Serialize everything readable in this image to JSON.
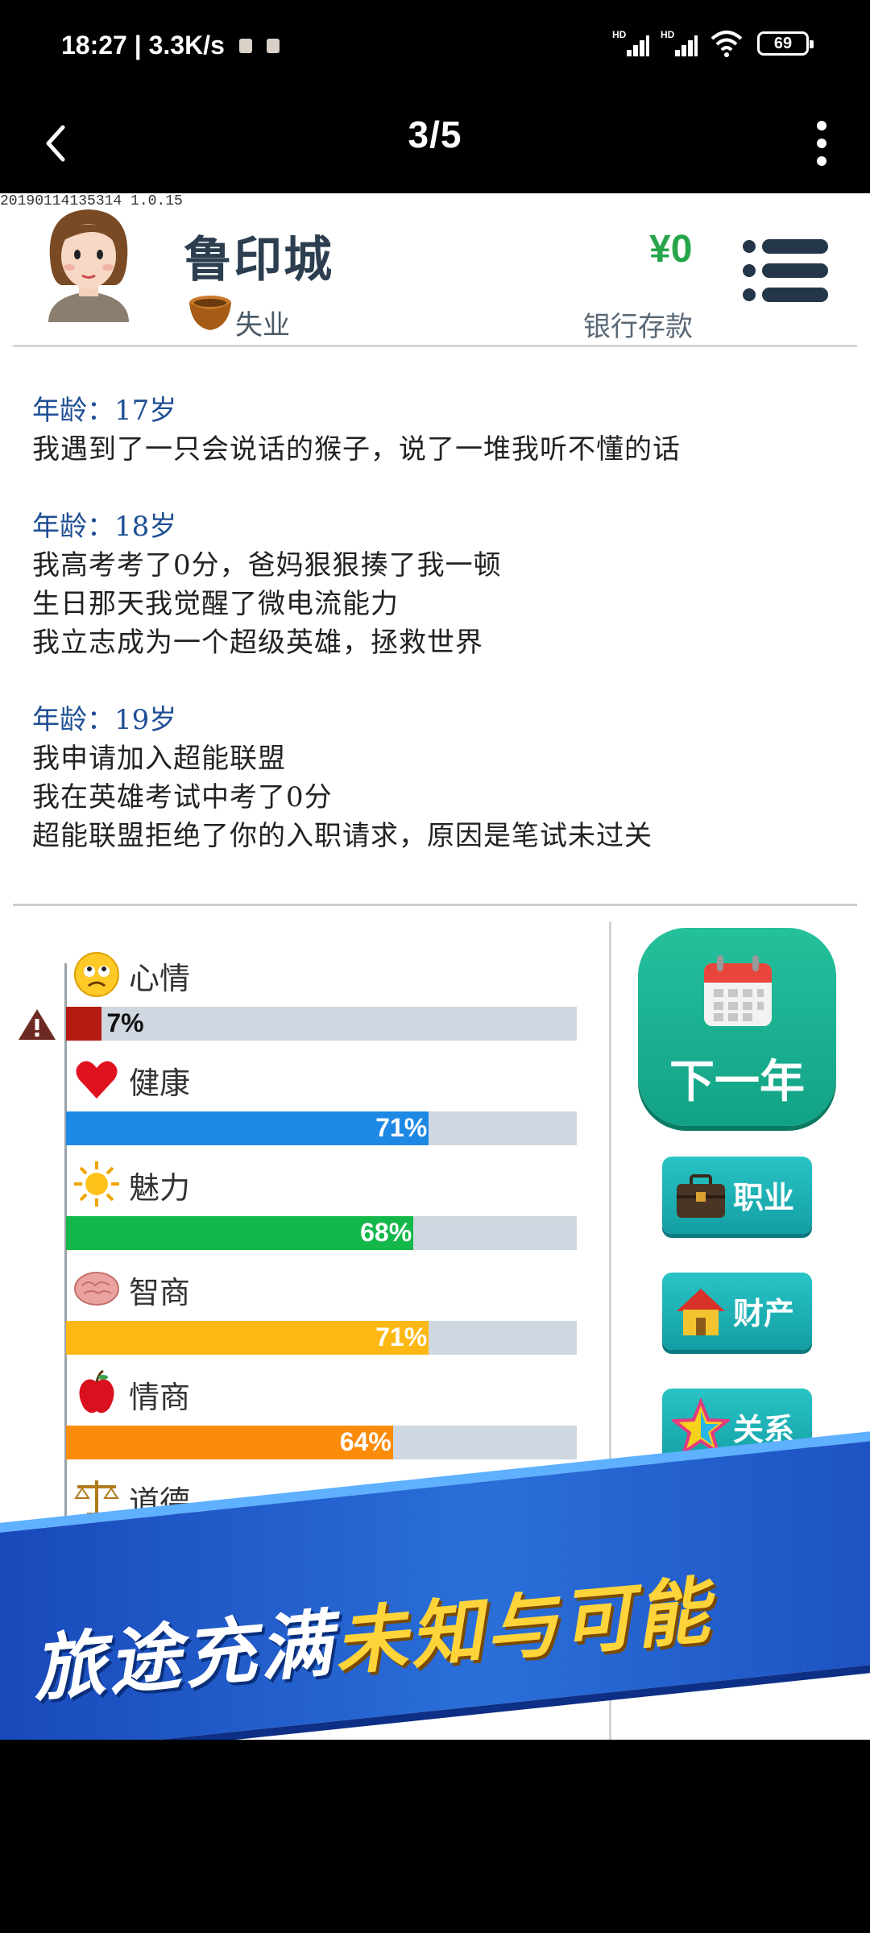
{
  "status_bar": {
    "time_speed": "18:27 | 3.3K/s",
    "battery": "69"
  },
  "nav": {
    "page_indicator": "3/5"
  },
  "game": {
    "version": "20190114135314 1.0.15",
    "player": {
      "name": "鲁印城",
      "job": "失业",
      "money": "¥0",
      "bank_label": "银行存款"
    },
    "log": [
      {
        "age": "年龄：17岁",
        "lines": [
          "我遇到了一只会说话的猴子，说了一堆我听不懂的话"
        ]
      },
      {
        "age": "年龄：18岁",
        "lines": [
          "我高考考了0分，爸妈狠狠揍了我一顿",
          "生日那天我觉醒了微电流能力",
          "我立志成为一个超级英雄，拯救世界"
        ]
      },
      {
        "age": "年龄：19岁",
        "lines": [
          "我申请加入超能联盟",
          "我在英雄考试中考了0分",
          "超能联盟拒绝了你的入职请求，原因是笔试未过关"
        ]
      }
    ],
    "stats": [
      {
        "label": "心情",
        "value": 7,
        "pct": "7%",
        "color": "#b51b10",
        "icon": "sad-face-icon"
      },
      {
        "label": "健康",
        "value": 71,
        "pct": "71%",
        "color": "#1e88e5",
        "icon": "heart-icon"
      },
      {
        "label": "魅力",
        "value": 68,
        "pct": "68%",
        "color": "#14b84a",
        "icon": "sun-icon"
      },
      {
        "label": "智商",
        "value": 71,
        "pct": "71%",
        "color": "#fdb814",
        "icon": "brain-icon"
      },
      {
        "label": "情商",
        "value": 64,
        "pct": "64%",
        "color": "#fb8c0a",
        "icon": "apple-icon"
      },
      {
        "label": "道德",
        "icon": "scale-icon"
      }
    ],
    "buttons": {
      "next_year": "下一年",
      "career": "职业",
      "property": "财产",
      "relations": "关系"
    },
    "banner": {
      "part1": "旅途充满",
      "part2": "未知与可能"
    }
  }
}
